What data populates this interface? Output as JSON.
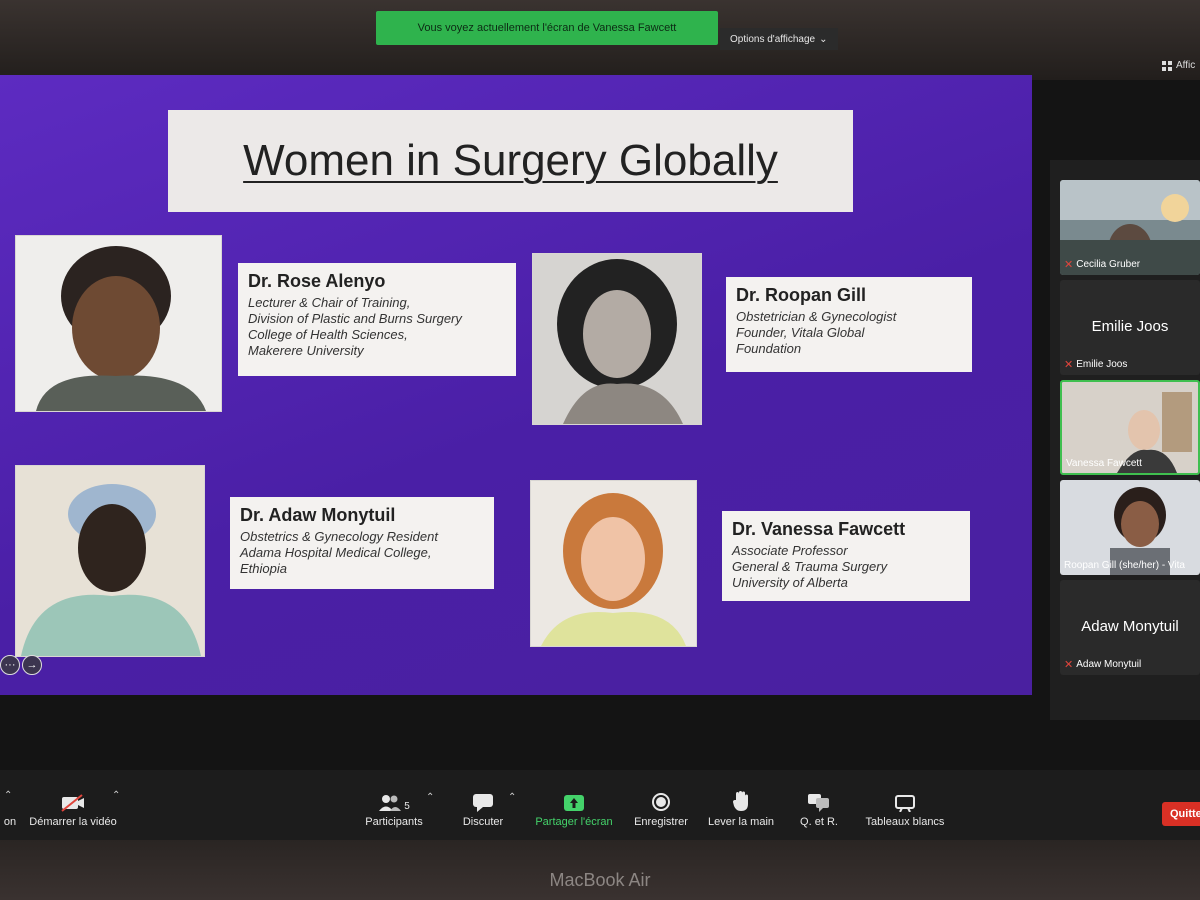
{
  "banner": {
    "text": "Vous voyez actuellement l'écran de Vanessa Fawcett"
  },
  "view_options": {
    "label": "Options d'affichage",
    "caret": "⌄"
  },
  "display_toggle": {
    "label": "Affic",
    "icon": "grid-icon"
  },
  "slide": {
    "title": "Women in Surgery Globally",
    "people": [
      {
        "name": "Dr. Rose Alenyo",
        "lines": [
          "Lecturer & Chair of Training,",
          "Division of Plastic and Burns Surgery",
          "College of Health Sciences,",
          "Makerere University"
        ]
      },
      {
        "name": "Dr. Roopan Gill",
        "lines": [
          "Obstetrician & Gynecologist",
          "Founder, Vitala Global",
          "Foundation"
        ]
      },
      {
        "name": "Dr. Adaw Monytuil",
        "lines": [
          "Obstetrics & Gynecology Resident",
          "Adama Hospital Medical College,",
          "Ethiopia"
        ]
      },
      {
        "name": "Dr. Vanessa Fawcett",
        "lines": [
          "Associate Professor",
          "General & Trauma Surgery",
          "University of Alberta"
        ]
      }
    ],
    "controls": {
      "more": "···",
      "next": "→"
    }
  },
  "participants_panel": [
    {
      "name": "Cecilia Gruber",
      "muted": true,
      "video": true
    },
    {
      "name": "Emilie Joos",
      "muted": true,
      "video": false
    },
    {
      "name": "Vanessa Fawcett",
      "muted": false,
      "video": true,
      "active": true
    },
    {
      "name": "Roopan Gill (she/her) - Vita",
      "muted": false,
      "video": true
    },
    {
      "name": "Adaw Monytuil",
      "muted": true,
      "video": false
    }
  ],
  "toolbar": {
    "audio_label": "on",
    "video_label": "Démarrer la vidéo",
    "participants_label": "Participants",
    "participants_count": "5",
    "chat_label": "Discuter",
    "share_label": "Partager l'écran",
    "record_label": "Enregistrer",
    "raise_hand_label": "Lever la main",
    "qa_label": "Q. et R.",
    "whiteboards_label": "Tableaux blancs",
    "quit_label": "Quitte"
  },
  "device_brand": "MacBook Air",
  "colors": {
    "accent_green": "#44d26a",
    "slide_purple": "#5d2bc1",
    "quit_red": "#d93025"
  }
}
